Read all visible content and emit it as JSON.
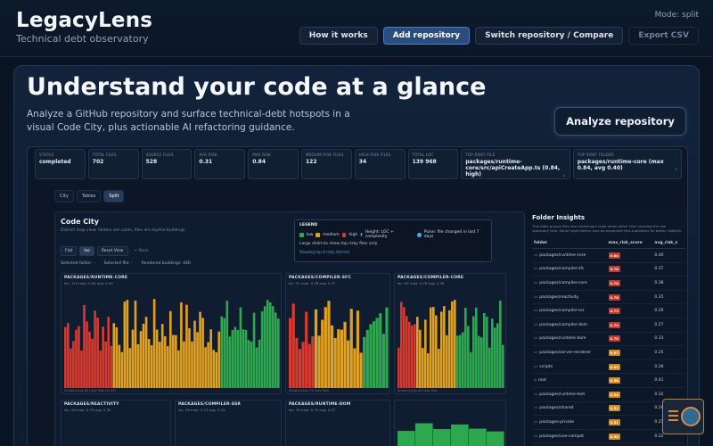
{
  "header": {
    "title": "LegacyLens",
    "subtitle": "Technical debt observatory",
    "mode": "Mode: split",
    "nav": [
      {
        "label": "How it works",
        "state": "normal"
      },
      {
        "label": "Add repository",
        "state": "active"
      },
      {
        "label": "Switch repository / Compare",
        "state": "normal"
      },
      {
        "label": "Export CSV",
        "state": "disabled"
      }
    ]
  },
  "hero": {
    "title": "Understand your code at a glance",
    "description": "Analyze a GitHub repository and surface technical-debt hotspots in a visual Code City, plus actionable AI refactoring guidance.",
    "analyze_label": "Analyze repository"
  },
  "stats": [
    {
      "label": "Status",
      "value": "completed"
    },
    {
      "label": "Total files",
      "value": "702"
    },
    {
      "label": "Source files",
      "value": "528"
    },
    {
      "label": "Avg risk",
      "value": "0.31"
    },
    {
      "label": "Max risk",
      "value": "0.84"
    },
    {
      "label": "Medium risk files",
      "value": "122"
    },
    {
      "label": "High risk files",
      "value": "34"
    },
    {
      "label": "Total LOC",
      "value": "139 968"
    },
    {
      "label": "Top risky file",
      "value": "packages/runtime-core/src/apiCreateApp.ts (0.84, high)",
      "badge": "high"
    },
    {
      "label": "Top risky folder",
      "value": "packages/runtime-core (max 0.84, avg 0.40)"
    }
  ],
  "view_tabs": [
    "City",
    "Tables",
    "Split"
  ],
  "city": {
    "title": "Code City",
    "subtitle": "District map view: folders are cards, files are skyline buildings.",
    "controls": [
      "Flat",
      "Iso",
      "Reset View",
      "← Back"
    ],
    "info": [
      "Selected folder: -",
      "Selected file: -",
      "Rendered buildings: 440"
    ],
    "legend": {
      "title": "LEGEND",
      "low": "low",
      "medium": "medium",
      "high": "high",
      "height": "Height: LOC + complexity",
      "pulse": "Pulse: file changed in last 7 days",
      "note": "Large districts show top risky files only",
      "link": "Showing top 8 risky districts"
    },
    "districts": [
      {
        "name": "PACKAGES/RUNTIME-CORE",
        "meta": "loc: 114 max: 0.84 avg: 0.40",
        "foot": "Showing top 80 risky files (of 92)"
      },
      {
        "name": "PACKAGES/COMPILER-SFC",
        "meta": "loc: 51 max: 0.78 avg: 0.37",
        "foot": "Showing top 31 risky files"
      },
      {
        "name": "PACKAGES/COMPILER-CORE",
        "meta": "loc: 62 max: 0.78 avg: 0.36",
        "foot": "Showing top 40 risky files"
      },
      {
        "name": "PACKAGES/REACTIVITY",
        "meta": "loc: 28 max: 0.76 avg: 0.35",
        "foot": ""
      },
      {
        "name": "PACKAGES/COMPILER-SSR",
        "meta": "loc: 26 max: 0.73 avg: 0.29",
        "foot": ""
      },
      {
        "name": "PACKAGES/RUNTIME-DOM",
        "meta": "loc: 34 max: 0.70 avg: 0.27",
        "foot": ""
      }
    ]
  },
  "folder_insights": {
    "title": "Folder Insights",
    "description": "This table groups files into meaningful code areas rather than showing the raw repository tree. Some large folders may be expanded into subfolders for better visibility.",
    "columns": [
      "folder",
      "max_risk_score",
      "avg_risk_s"
    ],
    "rows": [
      {
        "folder": "packages/runtime-core",
        "max": "0.84",
        "avg": "0.40",
        "color": "#c0392b"
      },
      {
        "folder": "packages/compiler-sfc",
        "max": "0.78",
        "avg": "0.37",
        "color": "#c0392b"
      },
      {
        "folder": "packages/compiler-core",
        "max": "0.78",
        "avg": "0.38",
        "color": "#c0392b"
      },
      {
        "folder": "packages/reactivity",
        "max": "0.76",
        "avg": "0.35",
        "color": "#c0392b"
      },
      {
        "folder": "packages/compiler-ssr",
        "max": "0.73",
        "avg": "0.29",
        "color": "#c0392b"
      },
      {
        "folder": "packages/compiler-dom",
        "max": "0.70",
        "avg": "0.27",
        "color": "#c0392b"
      },
      {
        "folder": "packages/runtime-dom",
        "max": "0.70",
        "avg": "0.33",
        "color": "#c0392b"
      },
      {
        "folder": "packages/server-renderer",
        "max": "0.67",
        "avg": "0.25",
        "color": "#d68a1e"
      },
      {
        "folder": "scripts",
        "max": "0.63",
        "avg": "0.28",
        "color": "#d68a1e"
      },
      {
        "folder": "root",
        "max": "0.58",
        "avg": "0.41",
        "color": "#d68a1e"
      },
      {
        "folder": "packages/runtime-test",
        "max": "0.54",
        "avg": "0.32",
        "color": "#d68a1e"
      },
      {
        "folder": "packages/shared",
        "max": "0.51",
        "avg": "0.26",
        "color": "#d68a1e"
      },
      {
        "folder": "packages-private",
        "max": "0.51",
        "avg": "0.25",
        "color": "#d68a1e"
      },
      {
        "folder": "packages/vue-compat",
        "max": "0.50",
        "avg": "0.22",
        "color": "#d68a1e"
      }
    ]
  },
  "colors": {
    "low": "#2ea84f",
    "medium": "#e0a020",
    "high": "#d63a2f",
    "accent": "#2b4d7e"
  },
  "icons": {
    "floating": "feedback-assistant-icon"
  }
}
